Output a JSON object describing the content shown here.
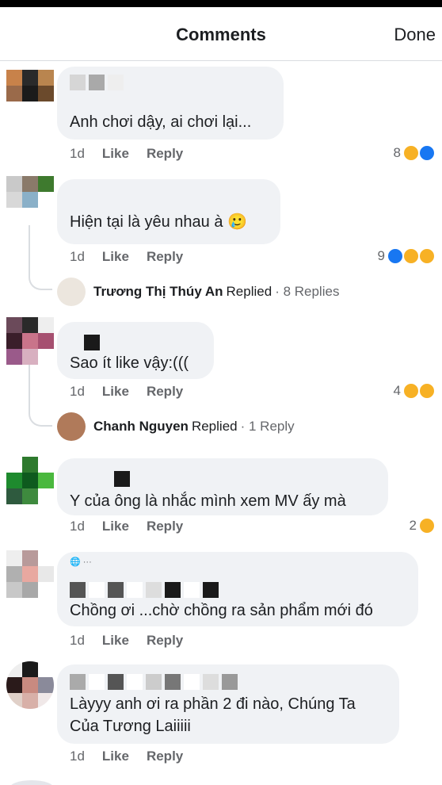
{
  "header": {
    "title": "Comments",
    "done_label": "Done"
  },
  "actions": {
    "like": "Like",
    "reply": "Reply"
  },
  "comments": [
    {
      "time": "1d",
      "text": "Anh chơi dậy, ai chơi lại...",
      "reaction_count": "8",
      "reactions": [
        "haha",
        "like"
      ]
    },
    {
      "time": "1d",
      "text": "Hiện tại là yêu nhau à 🥲",
      "reaction_count": "9",
      "reactions": [
        "like",
        "haha",
        "sad"
      ],
      "reply": {
        "name": "Trương Thị Thúy An",
        "label": "Replied",
        "count": "· 8 Replies"
      }
    },
    {
      "time": "1d",
      "text": "Sao ít like vậy:(((",
      "reaction_count": "4",
      "reactions": [
        "haha",
        "sad"
      ],
      "reply": {
        "name": "Chanh Nguyen",
        "label": "Replied",
        "count": "· 1 Reply"
      }
    },
    {
      "time": "1d",
      "text": "Y của ông là nhắc mình xem MV ấy mà",
      "reaction_count": "2",
      "reactions": [
        "haha"
      ]
    },
    {
      "time": "1d",
      "text": "Chồng ơi ...chờ chồng ra sản phẩm mới đó",
      "reaction_count": "",
      "reactions": []
    },
    {
      "time": "1d",
      "text": "Làyyy anh ơi ra phần 2 đi nào, Chúng Ta Của Tương Laiiiii",
      "reaction_count": "",
      "reactions": []
    }
  ],
  "colors": {
    "bubble": "#f0f2f5",
    "meta": "#65676b",
    "like_blue": "#1877f2",
    "haha_yellow": "#f7b125"
  }
}
